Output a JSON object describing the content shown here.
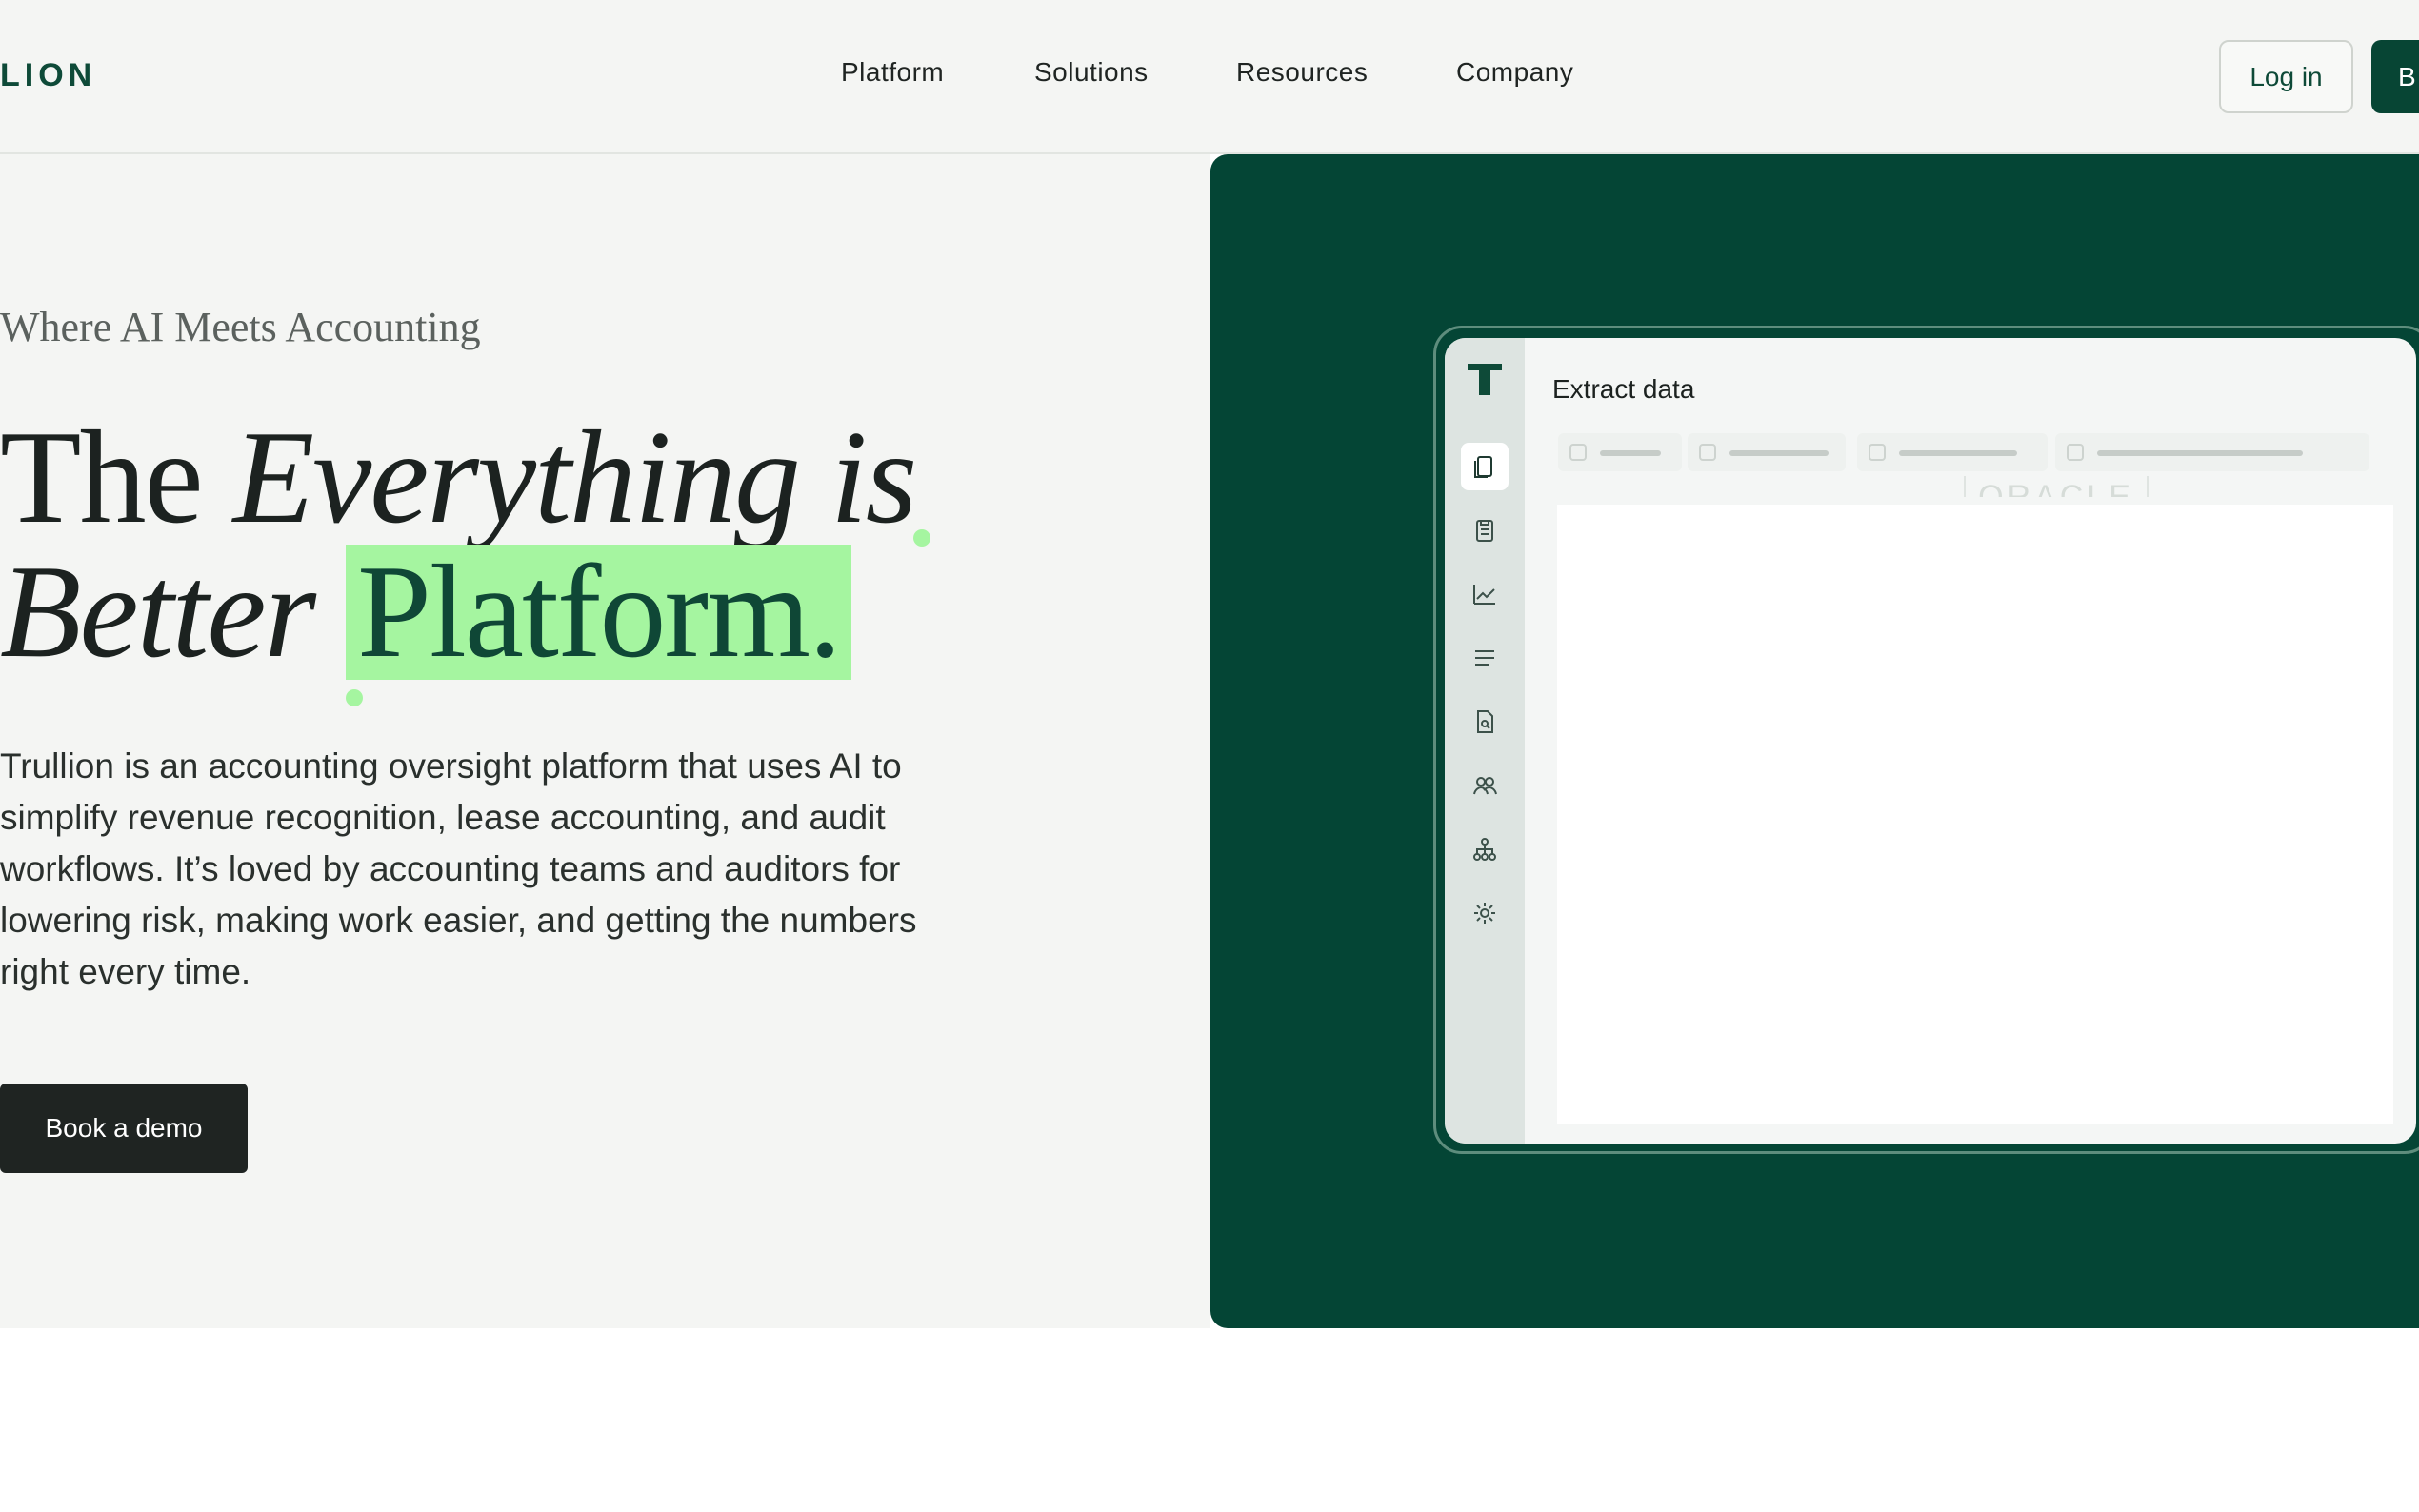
{
  "brand": {
    "logo_text": "LION"
  },
  "nav": {
    "items": [
      "Platform",
      "Solutions",
      "Resources",
      "Company"
    ]
  },
  "header": {
    "login_label": "Log in",
    "cta_label": "B"
  },
  "hero": {
    "eyebrow": "Where AI Meets Accounting",
    "headline": {
      "word1": "The",
      "word2": "Everything is",
      "word3": "Better",
      "word4": "Platform."
    },
    "description": "Trullion is an accounting oversight platform that uses AI to simplify revenue recognition, lease accounting, and audit workflows. It’s loved by accounting teams and auditors for lowering risk, making work easier, and getting the numbers right every time.",
    "cta_label": "Book a demo"
  },
  "app_preview": {
    "title": "Extract data",
    "watermark": "ORACLE",
    "sidebar_icons": [
      "documents-icon",
      "clipboard-icon",
      "chart-icon",
      "lines-icon",
      "file-search-icon",
      "users-icon",
      "hierarchy-icon",
      "gear-icon"
    ],
    "colors": {
      "panel_bg": "#044535",
      "accent": "#a5f5a0"
    }
  }
}
